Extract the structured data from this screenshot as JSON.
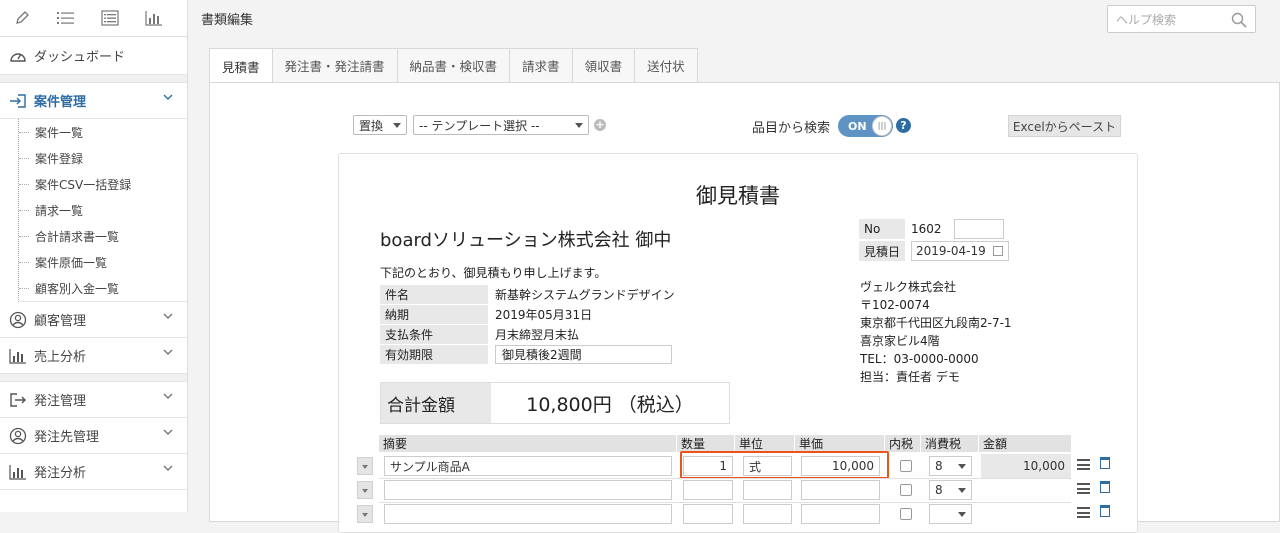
{
  "sidebar": {
    "toolbar_icons": [
      "pencil-icon",
      "list-icon",
      "list-box-icon",
      "bar-chart-icon"
    ],
    "dashboard": "ダッシュボード",
    "groups": [
      {
        "label": "案件管理",
        "active": true,
        "items": [
          "案件一覧",
          "案件登録",
          "案件CSV一括登録",
          "請求一覧",
          "合計請求書一覧",
          "案件原価一覧",
          "顧客別入金一覧"
        ]
      },
      {
        "label": "顧客管理"
      },
      {
        "label": "売上分析"
      },
      {
        "label": "発注管理"
      },
      {
        "label": "発注先管理"
      },
      {
        "label": "発注分析"
      }
    ]
  },
  "header": {
    "title": "書類編集",
    "search_placeholder": "ヘルプ検索"
  },
  "tabs": [
    "見積書",
    "発注書・発注請書",
    "納品書・検収書",
    "請求書",
    "領収書",
    "送付状"
  ],
  "controls": {
    "replace": "置換",
    "template": "-- テンプレート選択 --",
    "search_label": "品目から検索",
    "toggle": "ON",
    "excel": "Excelからペースト"
  },
  "doc": {
    "title": "御見積書",
    "client": "boardソリューション株式会社 御中",
    "intro": "下記のとおり、御見積もり申し上げます。",
    "info": [
      {
        "label": "件名",
        "value": "新基幹システムグランドデザイン"
      },
      {
        "label": "納期",
        "value": "2019年05月31日"
      },
      {
        "label": "支払条件",
        "value": "月末締翌月末払"
      },
      {
        "label": "有効期限",
        "value": "御見積後2週間"
      }
    ],
    "total_label": "合計金額",
    "total_value": "10,800円 （税込）",
    "no_label": "No",
    "no_value": "1602",
    "date_label": "見積日",
    "date_value": "2019-04-19",
    "company": [
      "ヴェルク株式会社",
      "〒102-0074",
      "東京都千代田区九段南2-7-1",
      "喜京家ビル4階",
      "TEL：03-0000-0000",
      "担当：責任者 デモ"
    ]
  },
  "items": {
    "headers": [
      "摘要",
      "数量",
      "単位",
      "単価",
      "内税",
      "消費税",
      "金額"
    ],
    "rows": [
      {
        "desc": "サンプル商品A",
        "qty": "1",
        "unit": "式",
        "price": "10,000",
        "tax": "8",
        "amount": "10,000"
      },
      {
        "desc": "",
        "qty": "",
        "unit": "",
        "price": "",
        "tax": "8",
        "amount": ""
      }
    ]
  }
}
